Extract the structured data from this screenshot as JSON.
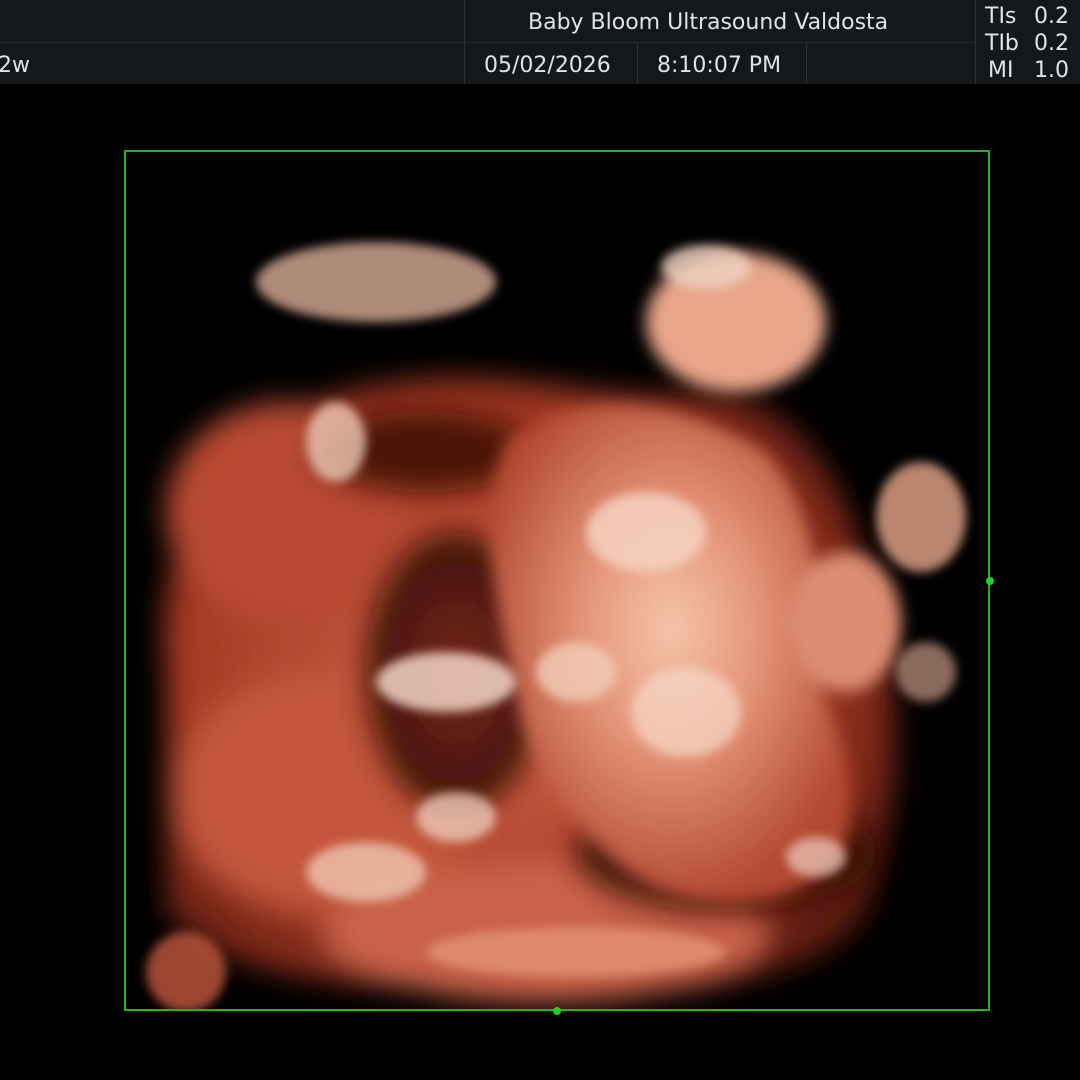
{
  "header": {
    "clinic_name": "Baby Bloom Ultrasound Valdosta",
    "gestation_fragment": "2w",
    "date": "05/02/2026",
    "time": "8:10:07 PM"
  },
  "indices": [
    {
      "label": "TIs",
      "value": "0.2"
    },
    {
      "label": "TIb",
      "value": "0.2"
    },
    {
      "label": "MI",
      "value": "1.0"
    }
  ],
  "colors": {
    "roi_border": "#1fb51f",
    "header_bg": "#14181b",
    "render_tissue": "#c0543c",
    "render_highlight": "#f1c8b2"
  }
}
